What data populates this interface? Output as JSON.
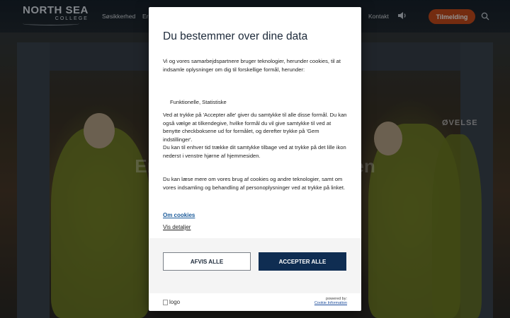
{
  "site": {
    "logo": {
      "main": "NORTH SEA",
      "sub": "COLLEGE"
    },
    "nav": {
      "items": [
        "Søsikkerhed",
        "Er",
        "Kontakt"
      ],
      "cta_label": "Tilmelding",
      "sound_icon": "speaker-icon",
      "search_icon": "search-icon"
    },
    "hero": {
      "title": "Er                                       en",
      "sign_text": "ØVELSE",
      "scroll_icon": "chevron-down-icon"
    }
  },
  "consent": {
    "title": "Du bestemmer over dine data",
    "intro": "Vi og vores samarbejdspartnere bruger teknologier, herunder cookies, til at indsamle oplysninger om dig til forskellige formål, herunder:",
    "purposes": "Funktionelle, Statistiske",
    "body_1": "Ved at trykke på 'Accepter alle' giver du samtykke til alle disse formål. Du kan også vælge at tilkendegive, hvilke formål du vil give samtykke til ved at benytte checkboksene ud for formålet, og derefter trykke på 'Gem indstillinger'.",
    "body_2": "Du kan til enhver tid trække dit samtykke tilbage ved at trykke på det lille ikon nederst i venstre hjørne af hjemmesiden.",
    "body_3": "Du kan læse mere om vores brug af cookies og andre teknologier, samt om vores indsamling og behandling af personoplysninger ved at trykke på linket.",
    "link_about": "Om cookies",
    "link_details": "Vis detaljer",
    "reject_label": "AFVIS ALLE",
    "accept_label": "ACCEPTER ALLE",
    "footer_logo_alt": "logo",
    "powered_by": "powered by:",
    "powered_link": "Cookie Information"
  },
  "colors": {
    "accept_bg": "#0f2d52",
    "cta_bg": "#c84c1c",
    "link": "#1a5a9a"
  }
}
